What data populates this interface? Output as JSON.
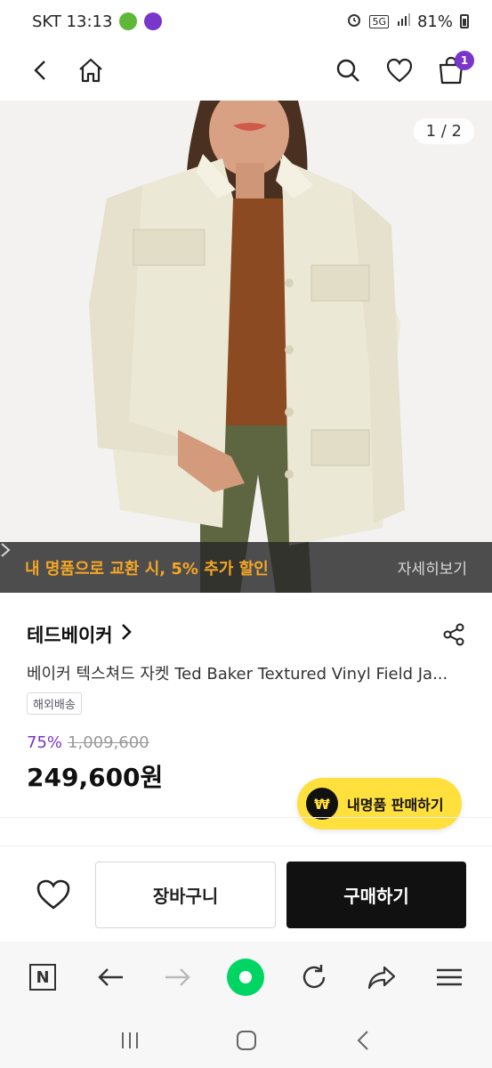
{
  "status": {
    "carrier_time": "SKT 13:13",
    "network": "5G",
    "battery": "81%"
  },
  "hero": {
    "page_indicator": "1 / 2",
    "promo_text": "내 명품으로 교환 시, 5% 추가 할인",
    "promo_more": "자세히보기"
  },
  "cart": {
    "count": "1"
  },
  "product": {
    "brand": "테드베이커",
    "title": "베이커 텍스쳐드 자켓 Ted Baker Textured Vinyl Field Ja...",
    "shipping_tag": "해외배송",
    "discount": "75%",
    "original_price": "1,009,600",
    "sale_price": "249,600원"
  },
  "sell_button": {
    "label": "내명품 판매하기",
    "icon_glyph": "₩"
  },
  "actions": {
    "cart_label": "장바구니",
    "buy_label": "구매하기"
  },
  "browser": {
    "home_glyph": "N"
  },
  "colors": {
    "accent_purple": "#7a35c9",
    "promo_orange": "#f6a623",
    "sell_yellow": "#ffe03c",
    "naver_green": "#00d564"
  }
}
